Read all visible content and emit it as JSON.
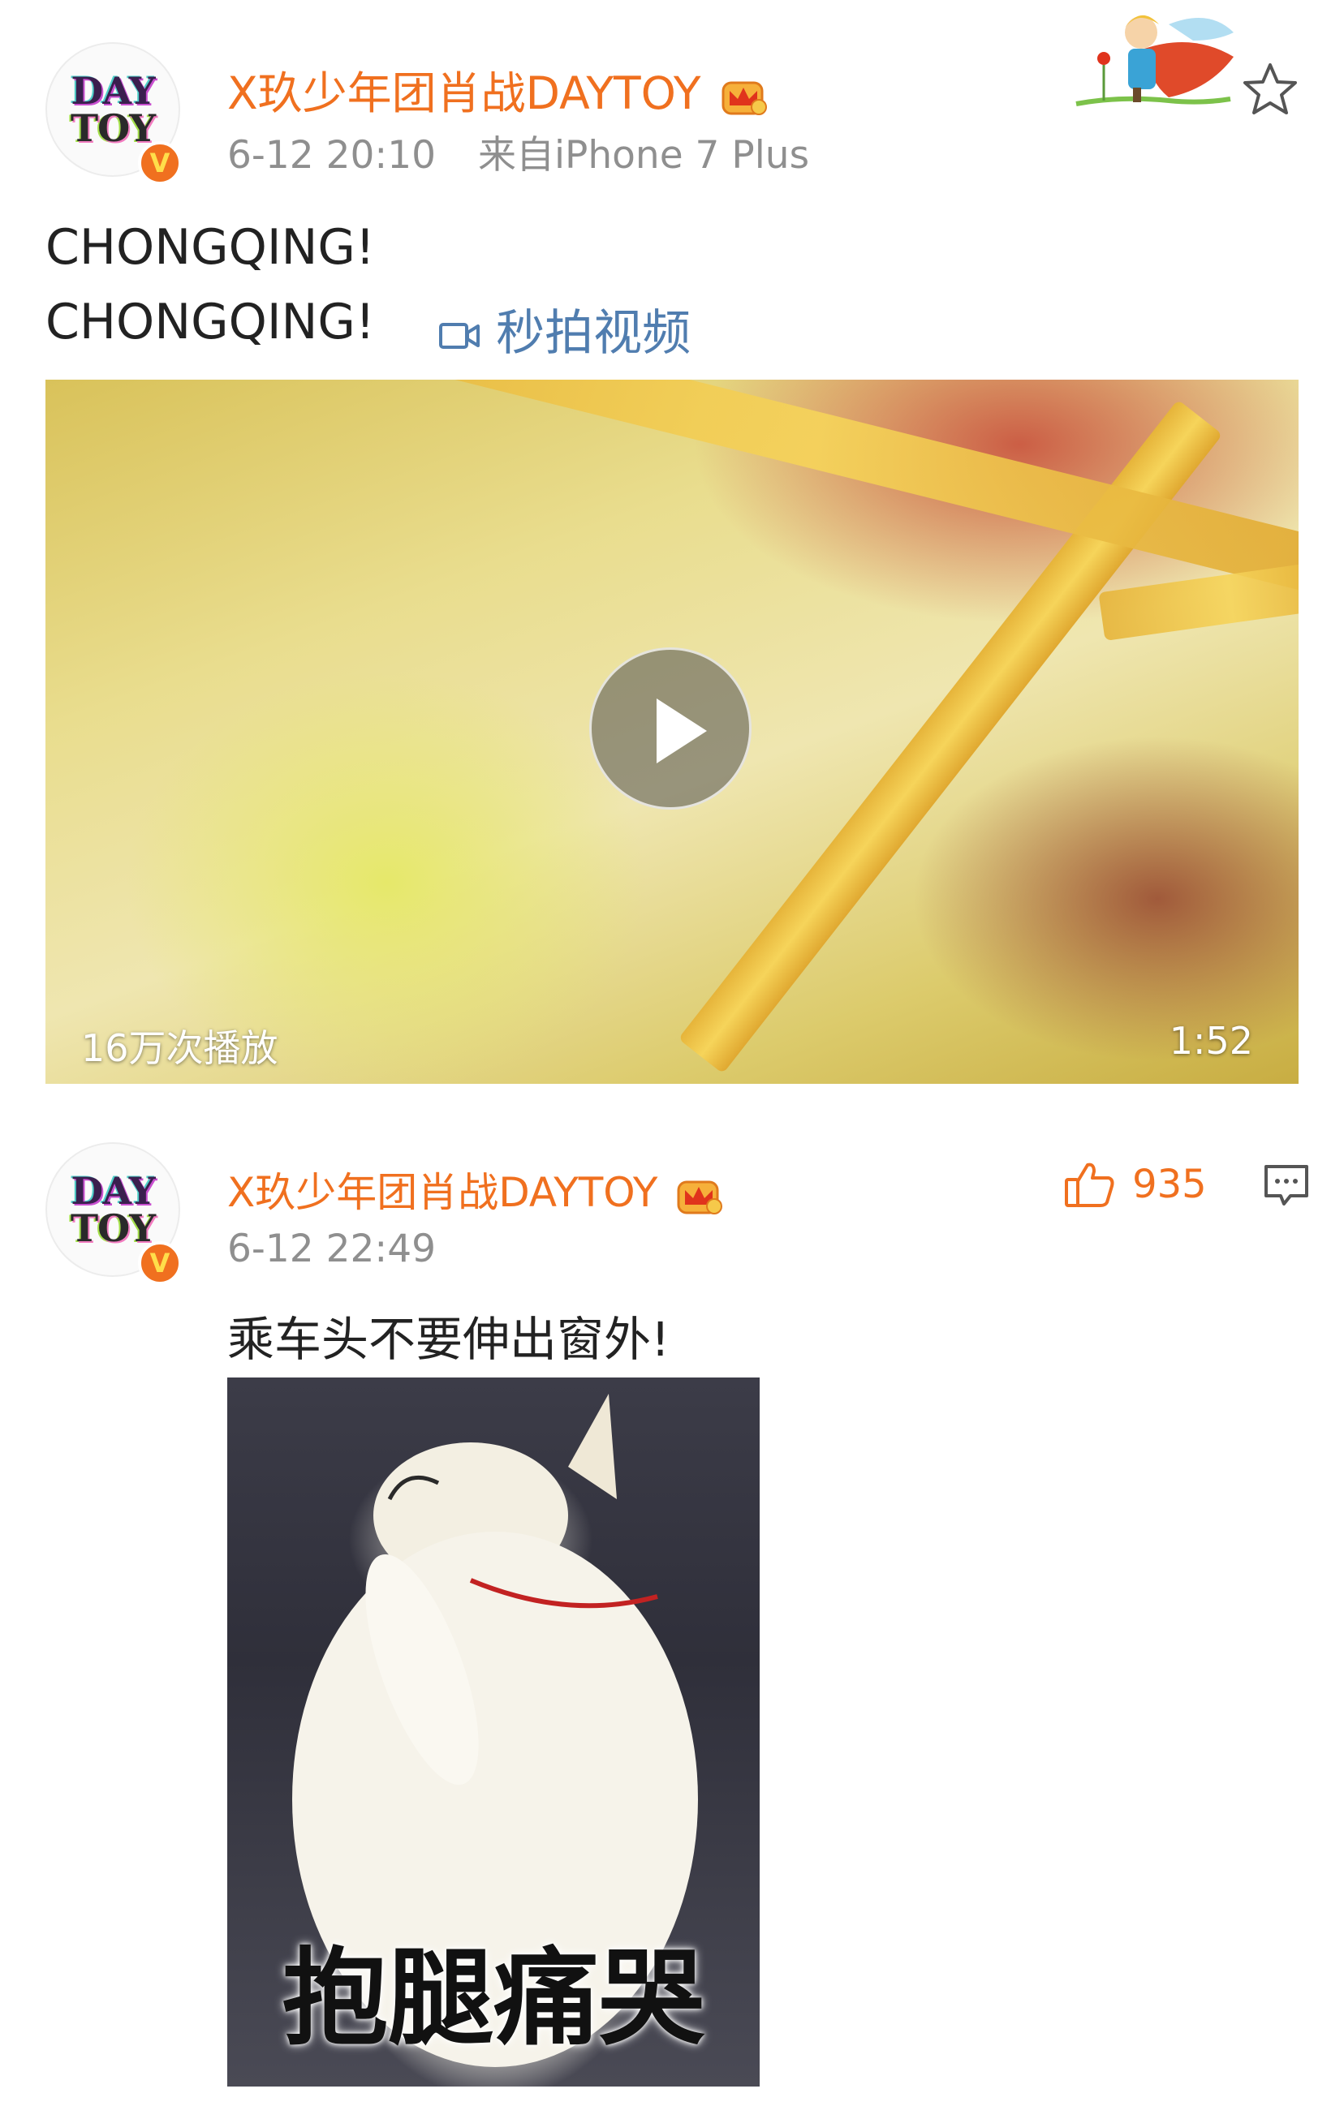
{
  "post1": {
    "username": "X玖少年团肖战DAYTOY",
    "timestamp": "6-12 20:10",
    "source": "来自iPhone 7 Plus",
    "text_lines": [
      "CHONGQING!",
      "CHONGQING!"
    ],
    "video_link_label": "秒拍视频",
    "video": {
      "views": "16万次播放",
      "duration": "1:52"
    }
  },
  "post2": {
    "username": "X玖少年团肖战DAYTOY",
    "timestamp": "6-12 22:49",
    "like_count": "935",
    "text": "乘车头不要伸出窗外!",
    "image_caption": "抱腿痛哭"
  },
  "avatar_text": {
    "line1": "DAY",
    "line2": "TOY"
  },
  "verified_badge": "V",
  "colors": {
    "accent": "#f0701f",
    "meta": "#8f8f8f",
    "link": "#507daf"
  },
  "icons": [
    "crown-badge-icon",
    "star-favorite-icon",
    "video-camera-icon",
    "play-icon",
    "thumbs-up-icon",
    "comment-icon"
  ]
}
